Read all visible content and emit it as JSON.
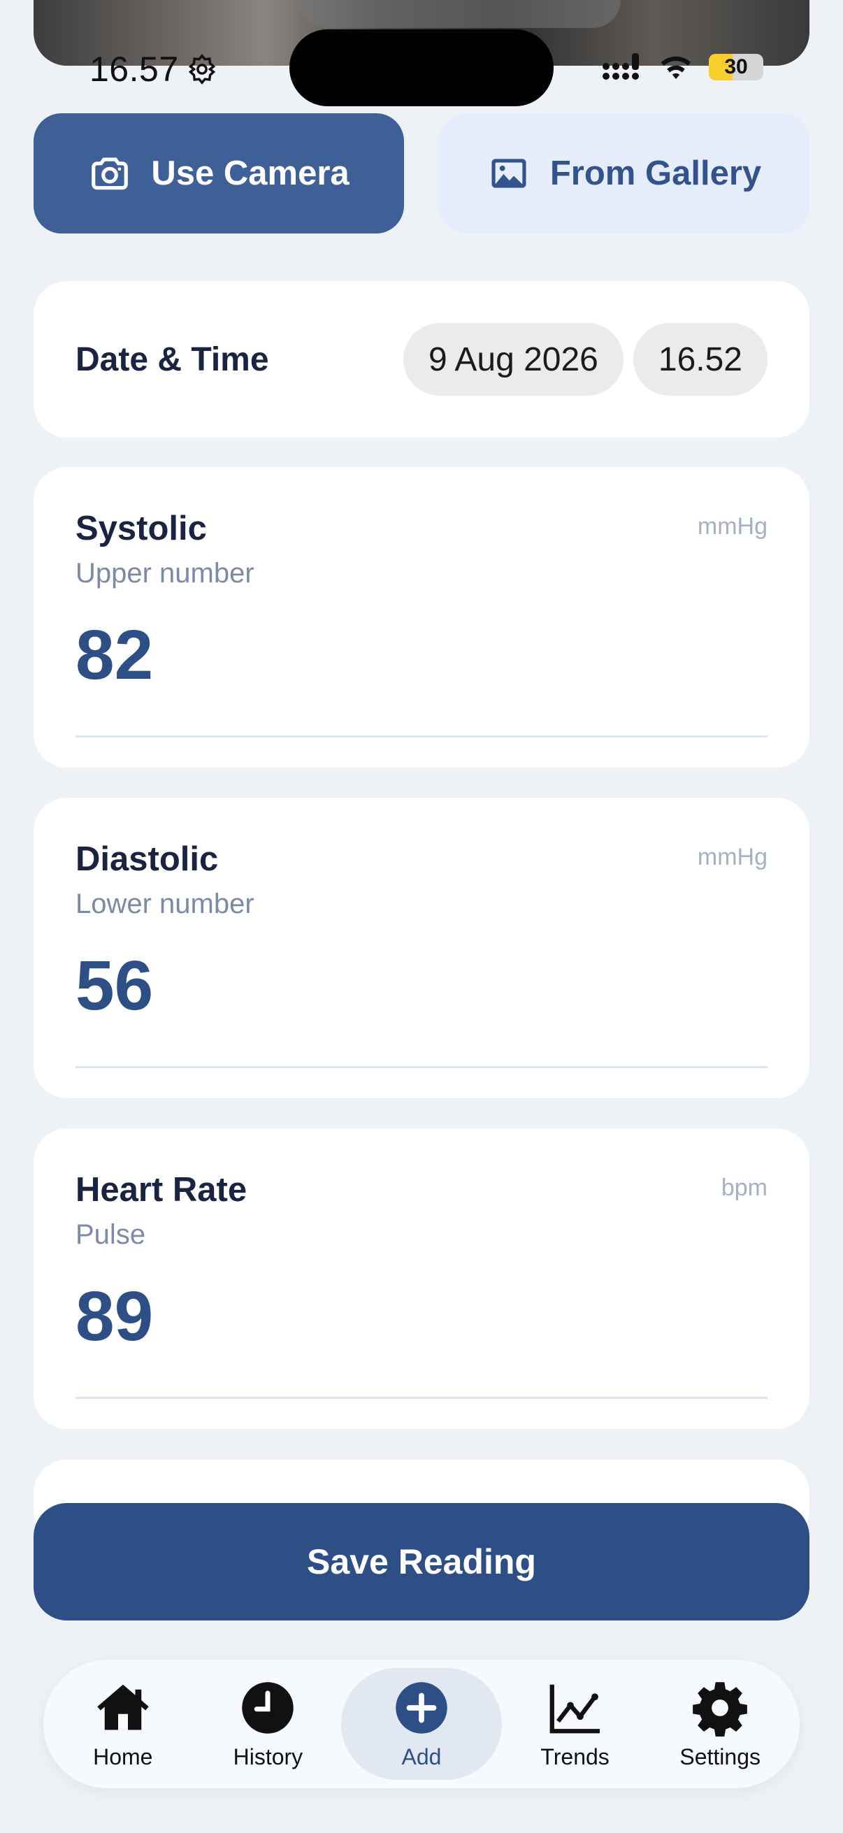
{
  "status_bar": {
    "time": "16.57",
    "battery": "30"
  },
  "actions": {
    "camera_label": "Use Camera",
    "gallery_label": "From Gallery"
  },
  "datetime": {
    "label": "Date & Time",
    "date": "9 Aug 2026",
    "time": "16.52"
  },
  "metrics": [
    {
      "title": "Systolic",
      "subtitle": "Upper number",
      "unit": "mmHg",
      "value": "82"
    },
    {
      "title": "Diastolic",
      "subtitle": "Lower number",
      "unit": "mmHg",
      "value": "56"
    },
    {
      "title": "Heart Rate",
      "subtitle": "Pulse",
      "unit": "bpm",
      "value": "89"
    }
  ],
  "save_label": "Save Reading",
  "nav": {
    "items": [
      {
        "label": "Home",
        "icon": "home-icon"
      },
      {
        "label": "History",
        "icon": "clock-icon"
      },
      {
        "label": "Add",
        "icon": "plus-circle-icon",
        "active": true
      },
      {
        "label": "Trends",
        "icon": "chart-line-icon"
      },
      {
        "label": "Settings",
        "icon": "gear-icon"
      }
    ]
  },
  "colors": {
    "primary": "#2e4f85",
    "camera_button": "#3f5f97",
    "gallery_button_bg": "#e4edf9",
    "background": "#eef1f6"
  }
}
